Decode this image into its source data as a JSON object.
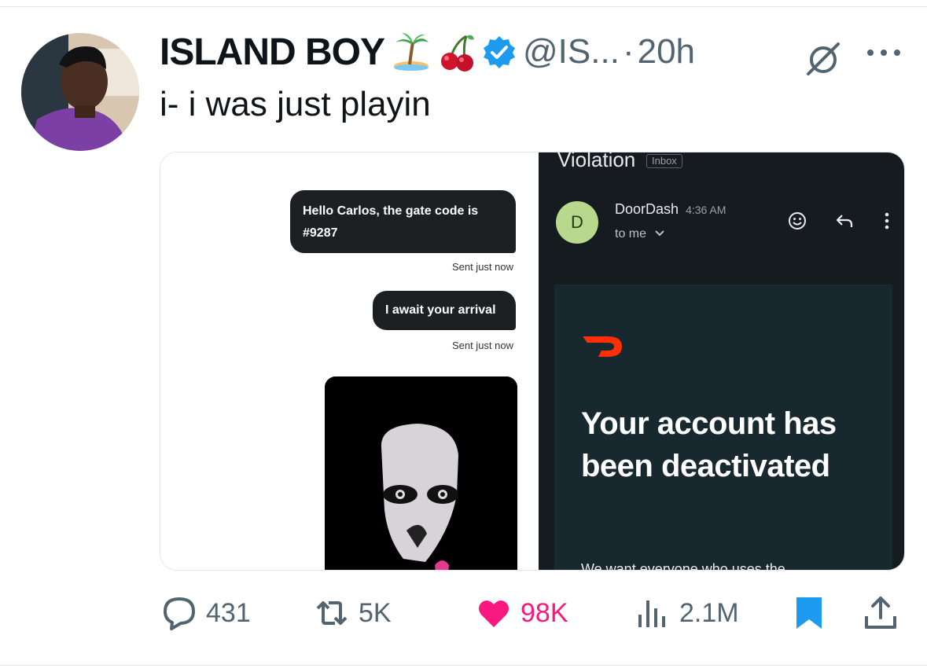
{
  "tweet": {
    "display_name": "ISLAND BOY",
    "emojis": [
      "palm-island-emoji",
      "cherries-emoji"
    ],
    "handle": "@IS...",
    "separator": "·",
    "time": "20h",
    "text": "i- i was just playin"
  },
  "media": {
    "left": {
      "message_1": "Hello Carlos, the gate code is #9287",
      "status_1": "Sent just now",
      "message_2": "I await your arrival",
      "status_2": "Sent just now"
    },
    "right": {
      "subject": "Violation",
      "badge": "Inbox",
      "sender_initial": "D",
      "sender_name": "DoorDash",
      "sender_time": "4:36 AM",
      "to_me": "to me",
      "headline": "Your account has been deactivated",
      "cut_off_text": "We want everyone who uses the"
    }
  },
  "actions": {
    "replies": "431",
    "retweets": "5K",
    "likes": "98K",
    "views": "2.1M"
  },
  "colors": {
    "like": "#f91880",
    "verified": "#1d9bf0",
    "bookmark": "#1d9bf0",
    "muted": "#536471"
  }
}
